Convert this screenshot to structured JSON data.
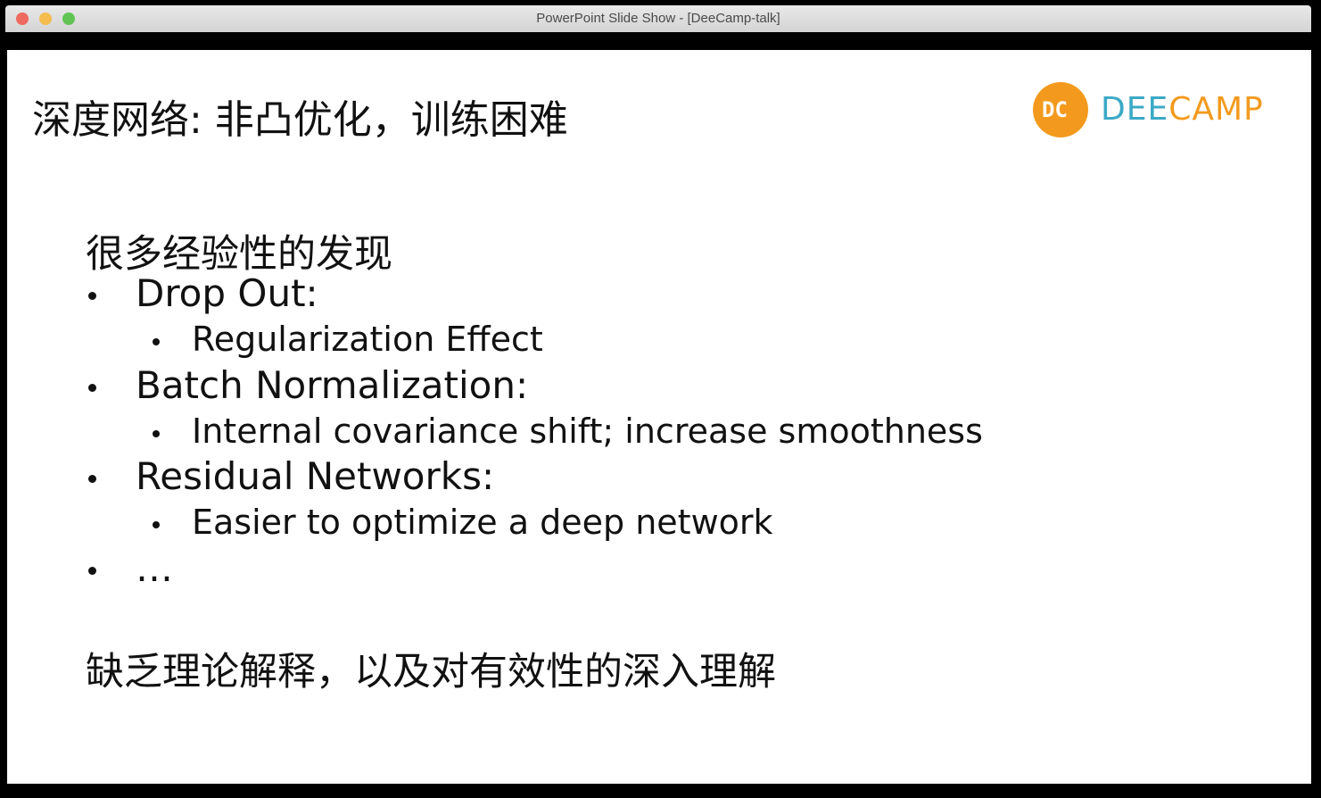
{
  "window": {
    "title": "PowerPoint Slide Show - [DeeCamp-talk]",
    "controls": {
      "close": "#ee6a5f",
      "minimize": "#f5bd4f",
      "maximize": "#61c454"
    }
  },
  "slide": {
    "title": "深度网络: 非凸优化，训练困难",
    "logo": {
      "mark": "DC",
      "text_part1": "DEE",
      "text_part2": "CAMP",
      "color_orange": "#f39a1e",
      "color_blue": "#3ba9c6"
    },
    "intro": "很多经验性的发现",
    "bullets": [
      {
        "label": "Drop Out:",
        "sub": "Regularization Effect"
      },
      {
        "label": "Batch Normalization:",
        "sub": "Internal covariance shift; increase smoothness"
      },
      {
        "label": "Residual Networks:",
        "sub": "Easier to optimize a deep network"
      },
      {
        "label": "…"
      }
    ],
    "conclusion": "缺乏理论解释，以及对有效性的深入理解"
  }
}
